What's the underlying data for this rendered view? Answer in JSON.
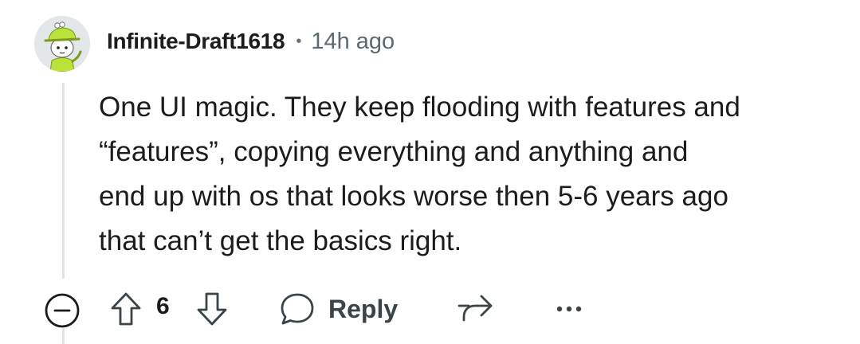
{
  "comment": {
    "author": "Infinite-Draft1618",
    "separator": "•",
    "time": "14h ago",
    "body_lines": [
      "One UI magic. They keep flooding with features and",
      "“features”, copying everything and anything and",
      "end up with os that looks worse then 5-6 years ago",
      "that can’t get the basics right."
    ]
  },
  "actions": {
    "collapse_icon": "minus-circle-icon",
    "upvote_icon": "arrow-up-icon",
    "vote_count": "6",
    "downvote_icon": "arrow-down-icon",
    "reply_icon": "speech-bubble-icon",
    "reply_label": "Reply",
    "share_icon": "share-icon",
    "more_icon": "ellipsis-icon"
  },
  "colors": {
    "avatar_hat": "#b9e23a",
    "avatar_shirt": "#b9e23a",
    "avatar_bg": "#e4e7ea",
    "text": "#1c1c1c",
    "meta": "#5c6a70",
    "thread_line": "#dfe3e6"
  }
}
